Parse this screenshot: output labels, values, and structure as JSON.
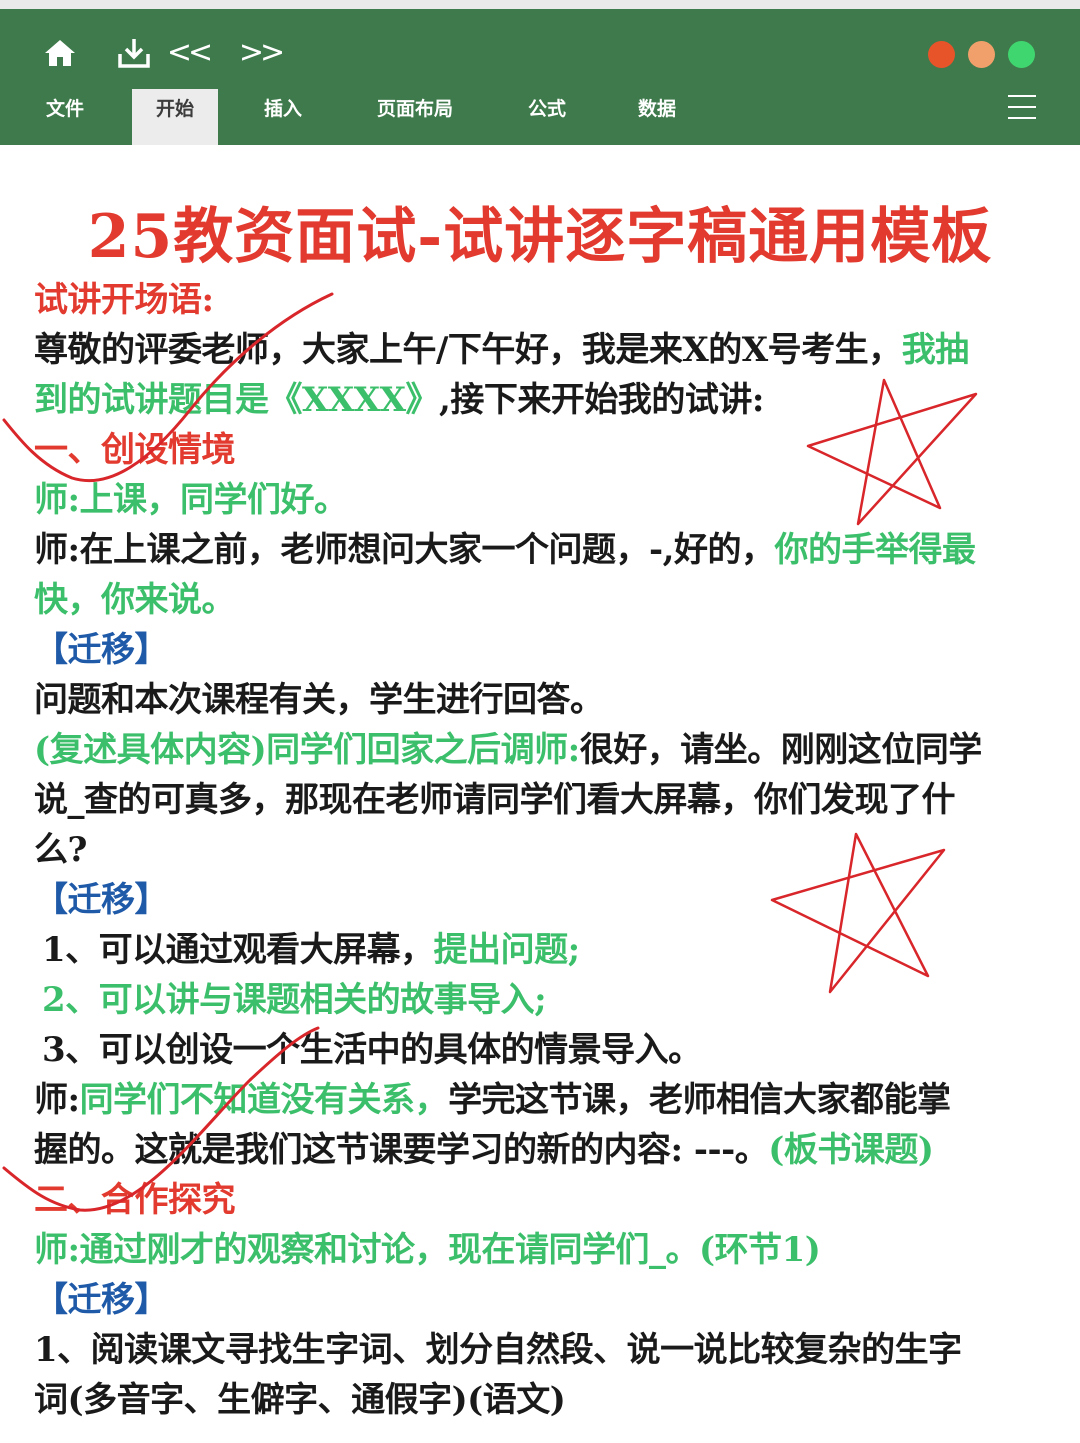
{
  "toolbar": {
    "icons": [
      "home-icon",
      "download-icon",
      "back-icon",
      "forward-icon"
    ],
    "back_glyph": "<<",
    "forward_glyph": ">>",
    "window_dots": [
      "#e8542a",
      "#f2a06b",
      "#40d66f"
    ],
    "tabs": [
      {
        "label": "文件",
        "active": false
      },
      {
        "label": "开始",
        "active": true
      },
      {
        "label": "插入",
        "active": false
      },
      {
        "label": "页面布局",
        "active": false
      },
      {
        "label": "公式",
        "active": false
      },
      {
        "label": "数据",
        "active": false
      }
    ],
    "menu_icon": "hamburger-menu-icon",
    "bar_color": "#3e7a4b"
  },
  "document": {
    "title": "25教资面试-试讲逐字稿通用模板",
    "colors": {
      "heading_red": "#e23a2e",
      "highlight_green": "#3cbf6b",
      "bracket_blue": "#1f5aa8",
      "body": "#1a1a1a"
    },
    "l1": "试讲开场语:",
    "l2a": "尊敬的评委老师，大家上午/下午好，我是来X的X号考生，",
    "l2b": "我抽",
    "l3a": "到的试讲题目是《XXXX》",
    "l3b": ",接下来开始我的试讲:",
    "l4": "一、创设情境",
    "l5": "师:上课，同学们好。",
    "l6a": "师:在上课之前，老师想问大家一个问题，-,好的，",
    "l6b": "你的手举得最",
    "l7": "快，你来说。",
    "l8": "【迁移】",
    "l9": "问题和本次课程有关，学生进行回答。",
    "l10a": "(复述具体内容)同学们回家之后调师:",
    "l10b": "很好，请坐。刚刚这位同学",
    "l11": "说_查的可真多，那现在老师请同学们看大屏幕，你们发现了什",
    "l12": "么?",
    "l13": "【迁移】",
    "l14a": "1、可以通过观看大屏幕，",
    "l14b": "提出问题;",
    "l15": "2、可以讲与课题相关的故事导入;",
    "l16": "3、可以创设一个生活中的具体的情景导入。",
    "l17a": "师:",
    "l17b": "同学们不知道没有关系，",
    "l17c": "学完这节课，老师相信大家都能掌",
    "l18a": "握的。这就是我们这节课要学习的新的内容: ---。",
    "l18b": "(板书课题)",
    "l19": "二、合作探究",
    "l20": "师:通过刚才的观察和讨论，现在请同学们_。(环节1)",
    "l21": "【迁移】",
    "l22": "1、阅读课文寻找生字词、划分自然段、说一说比较复杂的生字",
    "l23": "词(多音字、生僻字、通假字)(语文)"
  },
  "annotations": {
    "ink_color": "#d8262a",
    "marks": [
      "check-mark-1",
      "star-mark-1",
      "star-mark-2",
      "check-mark-2"
    ]
  }
}
